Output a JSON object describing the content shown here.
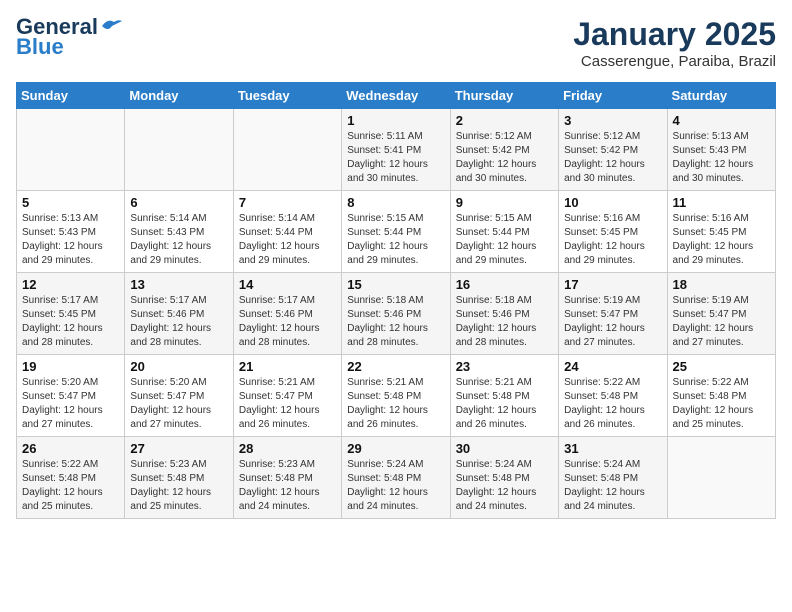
{
  "logo": {
    "general": "General",
    "blue": "Blue"
  },
  "title": "January 2025",
  "location": "Casserengue, Paraiba, Brazil",
  "days_header": [
    "Sunday",
    "Monday",
    "Tuesday",
    "Wednesday",
    "Thursday",
    "Friday",
    "Saturday"
  ],
  "weeks": [
    [
      {
        "day": "",
        "info": ""
      },
      {
        "day": "",
        "info": ""
      },
      {
        "day": "",
        "info": ""
      },
      {
        "day": "1",
        "info": "Sunrise: 5:11 AM\nSunset: 5:41 PM\nDaylight: 12 hours\nand 30 minutes."
      },
      {
        "day": "2",
        "info": "Sunrise: 5:12 AM\nSunset: 5:42 PM\nDaylight: 12 hours\nand 30 minutes."
      },
      {
        "day": "3",
        "info": "Sunrise: 5:12 AM\nSunset: 5:42 PM\nDaylight: 12 hours\nand 30 minutes."
      },
      {
        "day": "4",
        "info": "Sunrise: 5:13 AM\nSunset: 5:43 PM\nDaylight: 12 hours\nand 30 minutes."
      }
    ],
    [
      {
        "day": "5",
        "info": "Sunrise: 5:13 AM\nSunset: 5:43 PM\nDaylight: 12 hours\nand 29 minutes."
      },
      {
        "day": "6",
        "info": "Sunrise: 5:14 AM\nSunset: 5:43 PM\nDaylight: 12 hours\nand 29 minutes."
      },
      {
        "day": "7",
        "info": "Sunrise: 5:14 AM\nSunset: 5:44 PM\nDaylight: 12 hours\nand 29 minutes."
      },
      {
        "day": "8",
        "info": "Sunrise: 5:15 AM\nSunset: 5:44 PM\nDaylight: 12 hours\nand 29 minutes."
      },
      {
        "day": "9",
        "info": "Sunrise: 5:15 AM\nSunset: 5:44 PM\nDaylight: 12 hours\nand 29 minutes."
      },
      {
        "day": "10",
        "info": "Sunrise: 5:16 AM\nSunset: 5:45 PM\nDaylight: 12 hours\nand 29 minutes."
      },
      {
        "day": "11",
        "info": "Sunrise: 5:16 AM\nSunset: 5:45 PM\nDaylight: 12 hours\nand 29 minutes."
      }
    ],
    [
      {
        "day": "12",
        "info": "Sunrise: 5:17 AM\nSunset: 5:45 PM\nDaylight: 12 hours\nand 28 minutes."
      },
      {
        "day": "13",
        "info": "Sunrise: 5:17 AM\nSunset: 5:46 PM\nDaylight: 12 hours\nand 28 minutes."
      },
      {
        "day": "14",
        "info": "Sunrise: 5:17 AM\nSunset: 5:46 PM\nDaylight: 12 hours\nand 28 minutes."
      },
      {
        "day": "15",
        "info": "Sunrise: 5:18 AM\nSunset: 5:46 PM\nDaylight: 12 hours\nand 28 minutes."
      },
      {
        "day": "16",
        "info": "Sunrise: 5:18 AM\nSunset: 5:46 PM\nDaylight: 12 hours\nand 28 minutes."
      },
      {
        "day": "17",
        "info": "Sunrise: 5:19 AM\nSunset: 5:47 PM\nDaylight: 12 hours\nand 27 minutes."
      },
      {
        "day": "18",
        "info": "Sunrise: 5:19 AM\nSunset: 5:47 PM\nDaylight: 12 hours\nand 27 minutes."
      }
    ],
    [
      {
        "day": "19",
        "info": "Sunrise: 5:20 AM\nSunset: 5:47 PM\nDaylight: 12 hours\nand 27 minutes."
      },
      {
        "day": "20",
        "info": "Sunrise: 5:20 AM\nSunset: 5:47 PM\nDaylight: 12 hours\nand 27 minutes."
      },
      {
        "day": "21",
        "info": "Sunrise: 5:21 AM\nSunset: 5:47 PM\nDaylight: 12 hours\nand 26 minutes."
      },
      {
        "day": "22",
        "info": "Sunrise: 5:21 AM\nSunset: 5:48 PM\nDaylight: 12 hours\nand 26 minutes."
      },
      {
        "day": "23",
        "info": "Sunrise: 5:21 AM\nSunset: 5:48 PM\nDaylight: 12 hours\nand 26 minutes."
      },
      {
        "day": "24",
        "info": "Sunrise: 5:22 AM\nSunset: 5:48 PM\nDaylight: 12 hours\nand 26 minutes."
      },
      {
        "day": "25",
        "info": "Sunrise: 5:22 AM\nSunset: 5:48 PM\nDaylight: 12 hours\nand 25 minutes."
      }
    ],
    [
      {
        "day": "26",
        "info": "Sunrise: 5:22 AM\nSunset: 5:48 PM\nDaylight: 12 hours\nand 25 minutes."
      },
      {
        "day": "27",
        "info": "Sunrise: 5:23 AM\nSunset: 5:48 PM\nDaylight: 12 hours\nand 25 minutes."
      },
      {
        "day": "28",
        "info": "Sunrise: 5:23 AM\nSunset: 5:48 PM\nDaylight: 12 hours\nand 24 minutes."
      },
      {
        "day": "29",
        "info": "Sunrise: 5:24 AM\nSunset: 5:48 PM\nDaylight: 12 hours\nand 24 minutes."
      },
      {
        "day": "30",
        "info": "Sunrise: 5:24 AM\nSunset: 5:48 PM\nDaylight: 12 hours\nand 24 minutes."
      },
      {
        "day": "31",
        "info": "Sunrise: 5:24 AM\nSunset: 5:48 PM\nDaylight: 12 hours\nand 24 minutes."
      },
      {
        "day": "",
        "info": ""
      }
    ]
  ]
}
